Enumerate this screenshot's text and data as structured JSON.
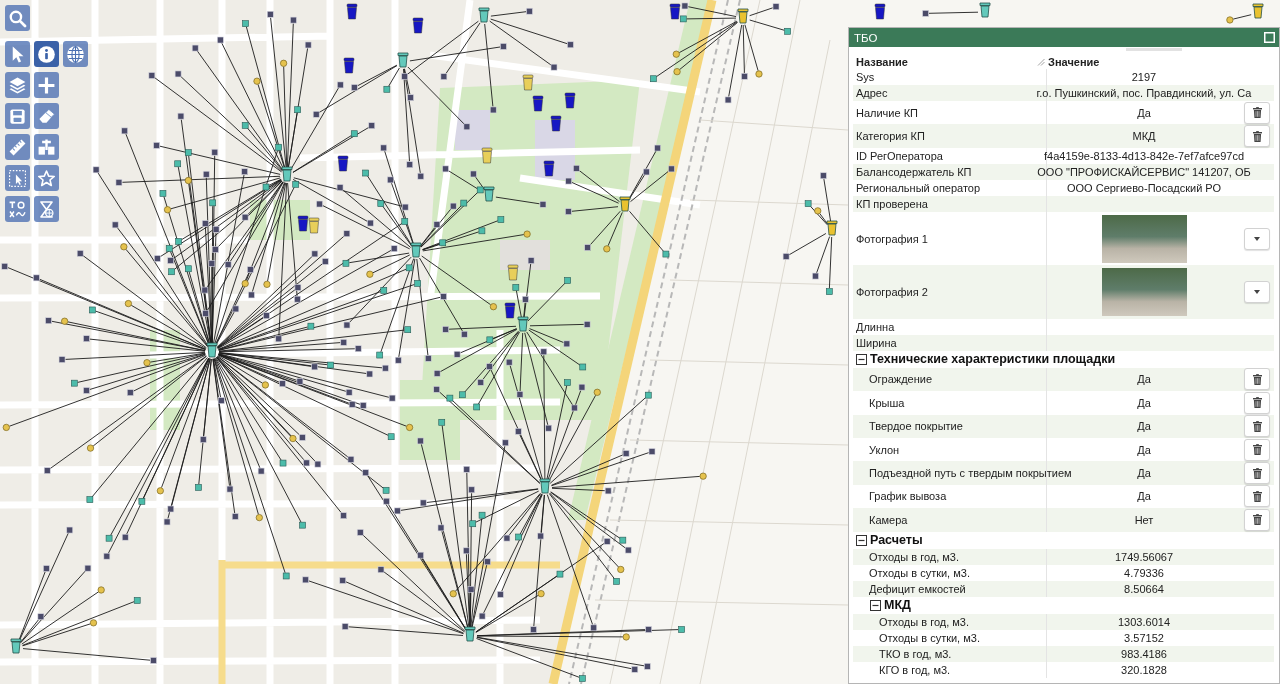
{
  "toolbar": {
    "rows": [
      [
        {
          "selected": false
        }
      ],
      [
        {
          "selected": false
        },
        {
          "selected": true
        },
        {
          "selected": false
        }
      ],
      [
        {
          "selected": false
        },
        {
          "selected": false
        }
      ],
      [
        {
          "selected": false
        },
        {
          "selected": false
        }
      ],
      [
        {
          "selected": false
        },
        {
          "selected": false
        }
      ],
      [
        {
          "selected": false
        },
        {
          "selected": false
        }
      ],
      [
        {
          "selected": false
        },
        {
          "selected": false
        }
      ]
    ]
  },
  "panel": {
    "title": "ТБО",
    "columns": [
      "Название",
      "Значение"
    ],
    "rows": [
      {
        "kind": "text",
        "label": "Sys",
        "value": "2197"
      },
      {
        "kind": "text",
        "label": "Адрес",
        "value": "г.о. Пушкинский, пос. Правдинский, ул. Са"
      },
      {
        "kind": "deletable",
        "label": "Наличие КП",
        "value": "Да"
      },
      {
        "kind": "deletable",
        "label": "Категория КП",
        "value": "МКД"
      },
      {
        "kind": "text",
        "label": "ID РегОператора",
        "value": "f4a4159e-8133-4d13-842e-7ef7afce97cd"
      },
      {
        "kind": "text",
        "label": "Балансодержатель КП",
        "value": "ООО \"ПРОФИСКАЙСЕРВИС\" 141207, ОБ"
      },
      {
        "kind": "text",
        "label": "Региональный оператор",
        "value": "ООО Сергиево-Посадский РО"
      },
      {
        "kind": "text",
        "label": "КП проверена"
      },
      {
        "kind": "photo",
        "label": "Фотография 1"
      },
      {
        "kind": "photo",
        "label": "Фотография 2"
      },
      {
        "kind": "text",
        "label": "Длинна"
      },
      {
        "kind": "text",
        "label": "Ширина"
      }
    ],
    "sections": [
      {
        "title": "Технические характеристики площадки",
        "expanded": true,
        "rows": [
          {
            "kind": "deletable",
            "label": "Ограждение",
            "value": "Да"
          },
          {
            "kind": "deletable",
            "label": "Крыша",
            "value": "Да"
          },
          {
            "kind": "deletable",
            "label": "Твердое покрытие",
            "value": "Да"
          },
          {
            "kind": "deletable",
            "label": "Уклон",
            "value": "Да"
          },
          {
            "kind": "deletable",
            "label": "Подъездной путь с твердым покрытием",
            "value": "Да"
          },
          {
            "kind": "deletable",
            "label": "График вывоза",
            "value": "Да"
          },
          {
            "kind": "deletable",
            "label": "Камера",
            "value": "Нет"
          }
        ]
      },
      {
        "title": "Расчеты",
        "expanded": true,
        "rows": [
          {
            "kind": "text",
            "label": "Отходы в год, м3.",
            "value": "1749.56067"
          },
          {
            "kind": "text",
            "label": "Отходы в сутки, м3.",
            "value": "4.79336"
          },
          {
            "kind": "text",
            "label": "Дефицит емкостей",
            "value": "8.50664"
          }
        ],
        "subsections": [
          {
            "title": "МКД",
            "expanded": true,
            "rows": [
              {
                "kind": "text",
                "label": "Отходы в год, м3.",
                "value": "1303.6014"
              },
              {
                "kind": "text",
                "label": "Отходы в сутки, м3.",
                "value": "3.57152"
              },
              {
                "kind": "text",
                "label": "ТКО в год, м3.",
                "value": "983.4186"
              },
              {
                "kind": "text",
                "label": "КГО в год, м3.",
                "value": "320.1828"
              }
            ]
          }
        ]
      }
    ]
  }
}
